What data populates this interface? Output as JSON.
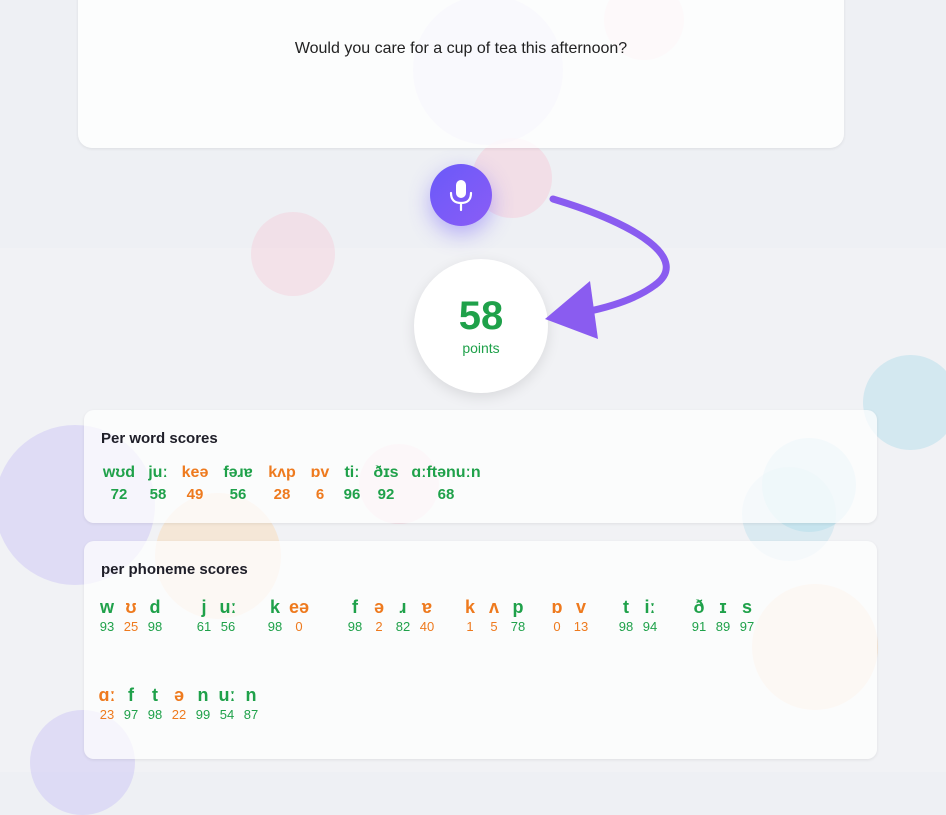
{
  "sentence": "Would you care for a cup of tea this afternoon?",
  "mic_icon": "microphone-icon",
  "arrow_icon": "curved-arrow-icon",
  "colors": {
    "good": "#1fa14a",
    "poor": "#ee7a1e",
    "accent": "#6a5af9"
  },
  "score": {
    "value": "58",
    "unit": "points"
  },
  "word_scores": {
    "title": "Per word scores",
    "words": [
      {
        "ipa": "wʊd",
        "score": "72",
        "level": "good"
      },
      {
        "ipa": "juː",
        "score": "58",
        "level": "good"
      },
      {
        "ipa": "keə",
        "score": "49",
        "level": "poor"
      },
      {
        "ipa": "fəɹɐ",
        "score": "56",
        "level": "good"
      },
      {
        "ipa": "kʌp",
        "score": "28",
        "level": "poor"
      },
      {
        "ipa": "ɒv",
        "score": "6",
        "level": "poor"
      },
      {
        "ipa": "tiː",
        "score": "96",
        "level": "good"
      },
      {
        "ipa": "ðɪs",
        "score": "92",
        "level": "good"
      },
      {
        "ipa": "ɑːftənuːn",
        "score": "68",
        "level": "good"
      }
    ]
  },
  "phoneme_scores": {
    "title": "per phoneme scores",
    "groups": [
      {
        "phonemes": [
          {
            "sym": "w",
            "score": "93",
            "level": "good"
          },
          {
            "sym": "ʊ",
            "score": "25",
            "level": "poor"
          },
          {
            "sym": "d",
            "score": "98",
            "level": "good"
          }
        ]
      },
      {
        "phonemes": [
          {
            "sym": "j",
            "score": "61",
            "level": "good"
          },
          {
            "sym": "uː",
            "score": "56",
            "level": "good"
          }
        ]
      },
      {
        "phonemes": [
          {
            "sym": "k",
            "score": "98",
            "level": "good"
          },
          {
            "sym": "eə",
            "score": "0",
            "level": "poor"
          }
        ]
      },
      {
        "phonemes": [
          {
            "sym": "f",
            "score": "98",
            "level": "good"
          },
          {
            "sym": "ə",
            "score": "2",
            "level": "poor"
          },
          {
            "sym": "ɹ",
            "score": "82",
            "level": "good"
          },
          {
            "sym": "ɐ",
            "score": "40",
            "level": "poor"
          }
        ]
      },
      {
        "phonemes": [
          {
            "sym": "k",
            "score": "1",
            "level": "poor"
          },
          {
            "sym": "ʌ",
            "score": "5",
            "level": "poor"
          },
          {
            "sym": "p",
            "score": "78",
            "level": "good"
          }
        ]
      },
      {
        "phonemes": [
          {
            "sym": "ɒ",
            "score": "0",
            "level": "poor"
          },
          {
            "sym": "v",
            "score": "13",
            "level": "poor"
          }
        ]
      },
      {
        "phonemes": [
          {
            "sym": "t",
            "score": "98",
            "level": "good"
          },
          {
            "sym": "iː",
            "score": "94",
            "level": "good"
          }
        ]
      },
      {
        "phonemes": [
          {
            "sym": "ð",
            "score": "91",
            "level": "good"
          },
          {
            "sym": "ɪ",
            "score": "89",
            "level": "good"
          },
          {
            "sym": "s",
            "score": "97",
            "level": "good"
          }
        ]
      },
      {
        "phonemes": [
          {
            "sym": "ɑː",
            "score": "23",
            "level": "poor"
          },
          {
            "sym": "f",
            "score": "97",
            "level": "good"
          },
          {
            "sym": "t",
            "score": "98",
            "level": "good"
          },
          {
            "sym": "ə",
            "score": "22",
            "level": "poor"
          },
          {
            "sym": "n",
            "score": "99",
            "level": "good"
          },
          {
            "sym": "uː",
            "score": "54",
            "level": "good"
          },
          {
            "sym": "n",
            "score": "87",
            "level": "good"
          }
        ]
      }
    ]
  }
}
